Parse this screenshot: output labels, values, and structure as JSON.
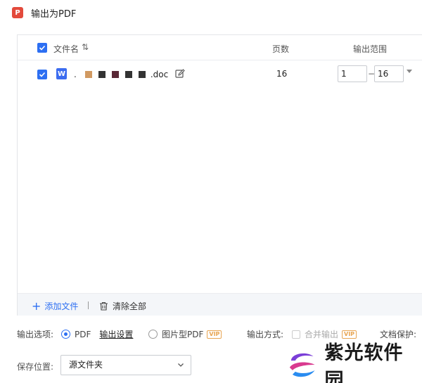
{
  "window": {
    "title": "输出为PDF",
    "icon": "pdf-app-icon",
    "icon_letter": "P"
  },
  "table": {
    "columns": {
      "filename": "文件名",
      "pages": "页数",
      "range": "输出范围"
    },
    "rows": [
      {
        "checked": true,
        "file_icon_letter": "W",
        "filename_prefix": ".",
        "filename_ext": ".doc",
        "pages": "16",
        "range_from": "1",
        "range_to": "16",
        "range_sep": "−"
      }
    ]
  },
  "bottombar": {
    "add_file": "添加文件",
    "clear_all": "清除全部",
    "add_glyph": "+"
  },
  "output": {
    "options_label": "输出选项:",
    "pdf_option": "PDF",
    "pdf_selected": true,
    "settings_link": "输出设置",
    "image_pdf_option": "图片型PDF",
    "vip_badge": "VIP",
    "method_label": "输出方式:",
    "merge_option": "合并输出",
    "protect_label": "文档保护:"
  },
  "save": {
    "label": "保存位置:",
    "value": "源文件夹"
  },
  "watermark": {
    "brand_text": "紫光软件园"
  },
  "colors": {
    "accent": "#2d6ff2",
    "vip": "#e8a552",
    "word_blue": "#3b6cf0",
    "pdf_red": "#e34a3c"
  }
}
